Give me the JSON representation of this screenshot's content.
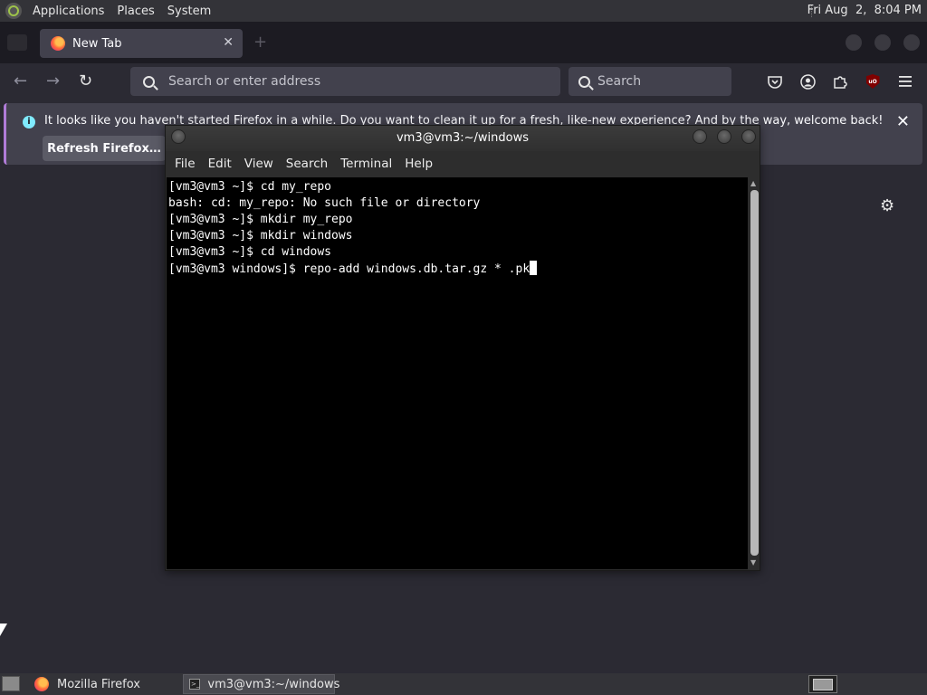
{
  "top_panel": {
    "menus": [
      "Applications",
      "Places",
      "System"
    ],
    "clock": "Fri Aug  2,  8:04 PM"
  },
  "firefox": {
    "tab": {
      "title": "New Tab",
      "close": "✕"
    },
    "new_tab": "+",
    "nav": {
      "back": "←",
      "forward": "→",
      "reload": "↻"
    },
    "url_placeholder": "Search or enter address",
    "search_placeholder": "Search",
    "notification": {
      "text": "It looks like you haven't started Firefox in a while. Do you want to clean it up for a fresh, like-new experience? And by the way, welcome back!",
      "button": "Refresh Firefox…",
      "close": "✕"
    },
    "gear": "⚙"
  },
  "terminal": {
    "title": "vm3@vm3:~/windows",
    "menu": [
      "File",
      "Edit",
      "View",
      "Search",
      "Terminal",
      "Help"
    ],
    "lines": [
      "[vm3@vm3 ~]$ cd my_repo",
      "bash: cd: my_repo: No such file or directory",
      "[vm3@vm3 ~]$ mkdir my_repo",
      "[vm3@vm3 ~]$ mkdir windows",
      "[vm3@vm3 ~]$ cd windows",
      "[vm3@vm3 windows]$ repo-add windows.db.tar.gz * .pk"
    ]
  },
  "taskbar": {
    "items": [
      {
        "label": "Mozilla Firefox"
      },
      {
        "label": "vm3@vm3:~/windows"
      }
    ]
  },
  "colors": {
    "panel": "#333338",
    "firefox_bg": "#2b2a33",
    "notice_accent": "#b07cd8",
    "terminal_bg": "#000000"
  }
}
